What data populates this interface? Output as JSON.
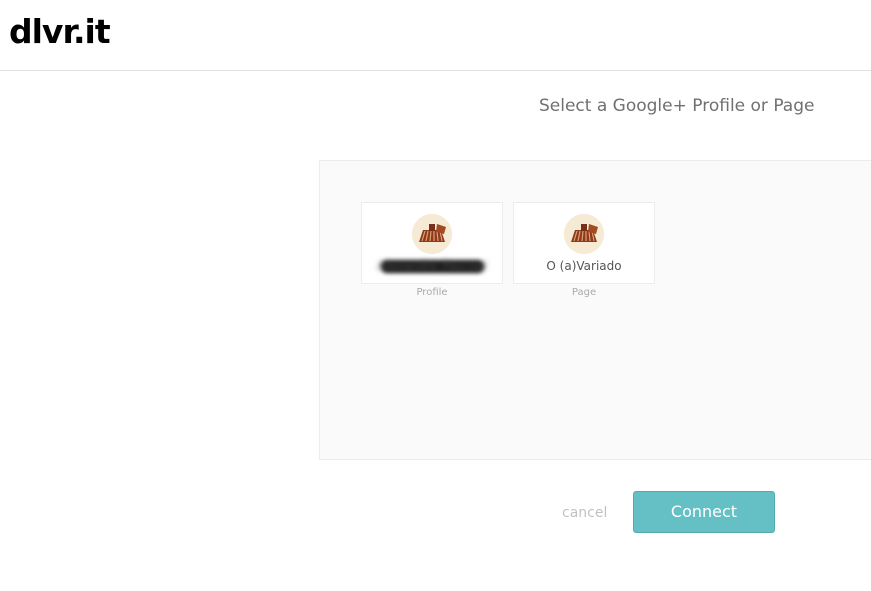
{
  "header": {
    "logo_text": "dlvr.it"
  },
  "main": {
    "title": "Select a Google+ Profile or Page",
    "accounts": [
      {
        "name": "Alexandre Pascoal",
        "type": "Profile",
        "avatar_icon": "gear-avatar-icon",
        "redacted": true
      },
      {
        "name": "O (a)Variado",
        "type": "Page",
        "avatar_icon": "gear-avatar-icon",
        "redacted": false
      }
    ]
  },
  "actions": {
    "cancel_label": "cancel",
    "connect_label": "Connect"
  },
  "colors": {
    "connect_button": "#64c0c4",
    "title_text": "#707070",
    "panel_bg": "#fafafa"
  }
}
